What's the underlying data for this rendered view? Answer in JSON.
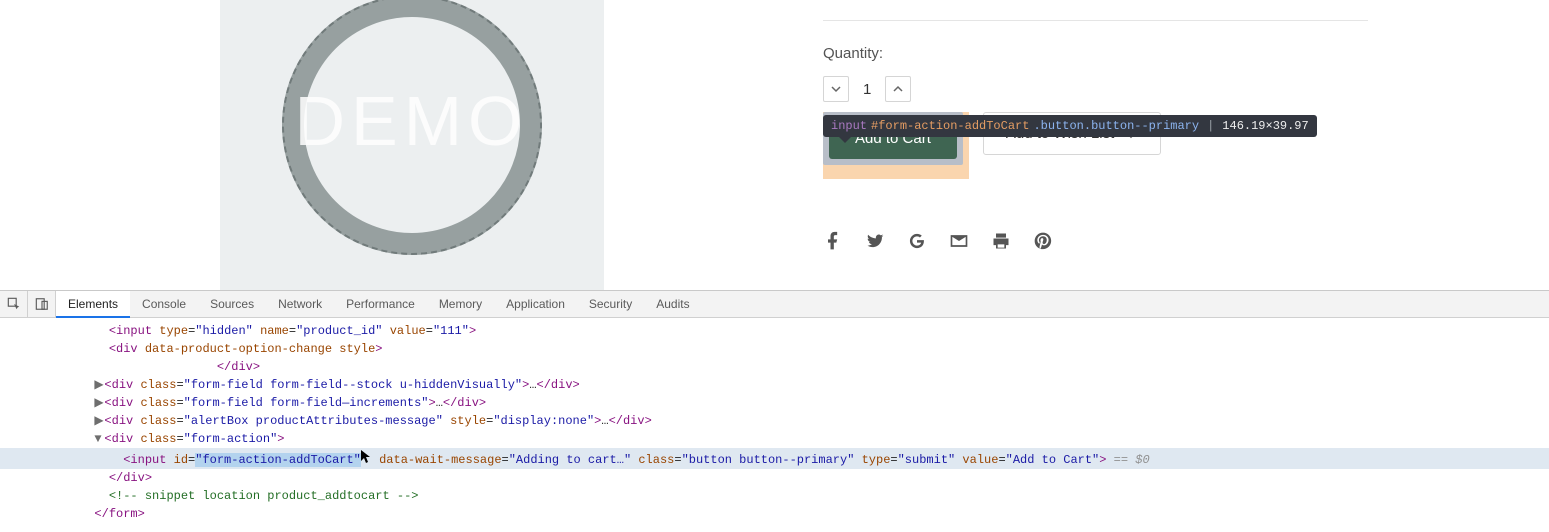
{
  "product": {
    "image_overlay": "DEMO",
    "quantity_label": "Quantity:",
    "quantity_value": "1",
    "add_to_cart_label": "Add to Cart",
    "wishlist_label": "Add to Wish List"
  },
  "inspect_tooltip": {
    "tag": "input",
    "id": "#form-action-addToCart",
    "classes": ".button.button--primary",
    "separator": "|",
    "dimensions": "146.19×39.97"
  },
  "share_icons": [
    "facebook",
    "twitter",
    "google",
    "email",
    "print",
    "pinterest"
  ],
  "devtools": {
    "tabs": [
      "Elements",
      "Console",
      "Sources",
      "Network",
      "Performance",
      "Memory",
      "Application",
      "Security",
      "Audits"
    ],
    "active_tab": "Elements",
    "eq0": "== $0",
    "code": {
      "l1": {
        "tag_open": "<input ",
        "a1": "type",
        "v1": "\"hidden\"",
        "a2": "name",
        "v2": "\"product_id\"",
        "a3": "value",
        "v3": "\"111\"",
        "tag_close": ">"
      },
      "l2": {
        "tag_open": "<div ",
        "a1": "data-product-option-change",
        "a2": "style",
        "tag_close": ">"
      },
      "l3": {
        "close": "</div>"
      },
      "l4": {
        "tag_open": "<div ",
        "a1": "class",
        "v1": "\"form-field form-field--stock u-hiddenVisually\"",
        "ell": "…",
        "close": "</div>"
      },
      "l5": {
        "tag_open": "<div ",
        "a1": "class",
        "v1": "\"form-field form-field—increments\"",
        "ell": "…",
        "close": "</div>"
      },
      "l6": {
        "tag_open": "<div ",
        "a1": "class",
        "v1": "\"alertBox productAttributes-message\"",
        "a2": "style",
        "v2": "\"display:none\"",
        "ell": "…",
        "close": "</div>"
      },
      "l7": {
        "tag_open": "<div ",
        "a1": "class",
        "v1": "\"form-action\"",
        "tag_close": ">"
      },
      "l8": {
        "tag_open": "<input ",
        "a1": "id",
        "v1": "\"form-action-addToCart\"",
        "a2": "data-wait-message",
        "v2": "\"Adding to cart…\"",
        "a3": "class",
        "v3": "\"button button--primary\"",
        "a4": "type",
        "v4": "\"submit\"",
        "a5": "value",
        "v5": "\"Add to Cart\"",
        "tag_close": ">"
      },
      "l9": {
        "close": "</div>"
      },
      "l10": {
        "comment": "!-- snippet location product_addtocart --"
      },
      "l11": {
        "close": "</form>"
      }
    }
  }
}
